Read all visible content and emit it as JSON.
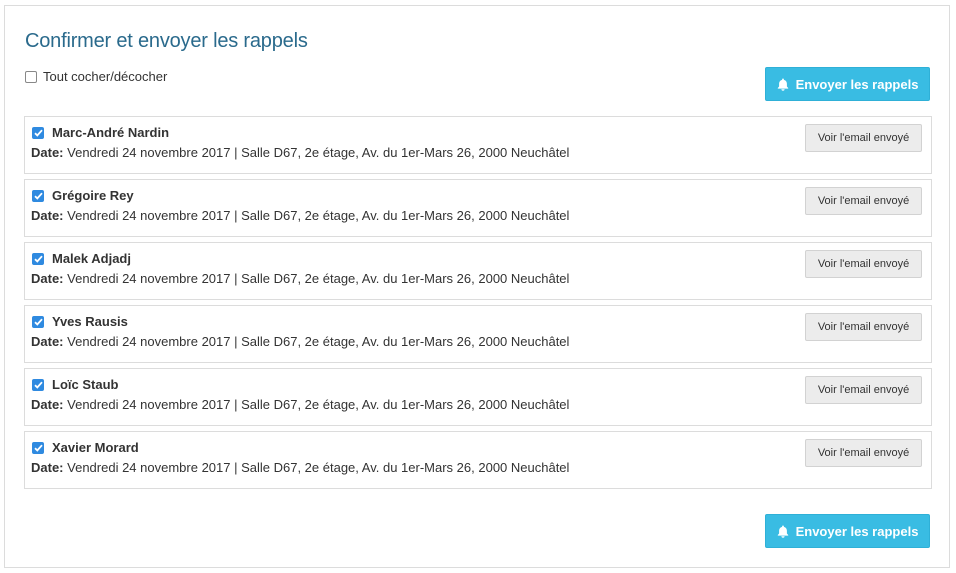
{
  "page": {
    "title": "Confirmer et envoyer les rappels",
    "toggle_all_label": "Tout cocher/décocher",
    "send_button_label": "Envoyer les rappels",
    "accent_color": "#39bce3",
    "title_color": "#2a6a8c"
  },
  "reminders": [
    {
      "name": "Marc-André Nardin",
      "checked": true,
      "date_label": "Date:",
      "details": "Vendredi 24 novembre 2017 | Salle D67, 2e étage, Av. du 1er-Mars 26, 2000 Neuchâtel",
      "view_button_label": "Voir l'email envoyé"
    },
    {
      "name": "Grégoire Rey",
      "checked": true,
      "date_label": "Date:",
      "details": "Vendredi 24 novembre 2017 | Salle D67, 2e étage, Av. du 1er-Mars 26, 2000 Neuchâtel",
      "view_button_label": "Voir l'email envoyé"
    },
    {
      "name": "Malek Adjadj",
      "checked": true,
      "date_label": "Date:",
      "details": "Vendredi 24 novembre 2017 | Salle D67, 2e étage, Av. du 1er-Mars 26, 2000 Neuchâtel",
      "view_button_label": "Voir l'email envoyé"
    },
    {
      "name": "Yves Rausis",
      "checked": true,
      "date_label": "Date:",
      "details": "Vendredi 24 novembre 2017 | Salle D67, 2e étage, Av. du 1er-Mars 26, 2000 Neuchâtel",
      "view_button_label": "Voir l'email envoyé"
    },
    {
      "name": "Loïc Staub",
      "checked": true,
      "date_label": "Date:",
      "details": "Vendredi 24 novembre 2017 | Salle D67, 2e étage, Av. du 1er-Mars 26, 2000 Neuchâtel",
      "view_button_label": "Voir l'email envoyé"
    },
    {
      "name": "Xavier Morard",
      "checked": true,
      "date_label": "Date:",
      "details": "Vendredi 24 novembre 2017 | Salle D67, 2e étage, Av. du 1er-Mars 26, 2000 Neuchâtel",
      "view_button_label": "Voir l'email envoyé"
    }
  ],
  "icons": {
    "send_button_icon": "bell-icon",
    "checkbox_icon": "checkmark-icon"
  }
}
